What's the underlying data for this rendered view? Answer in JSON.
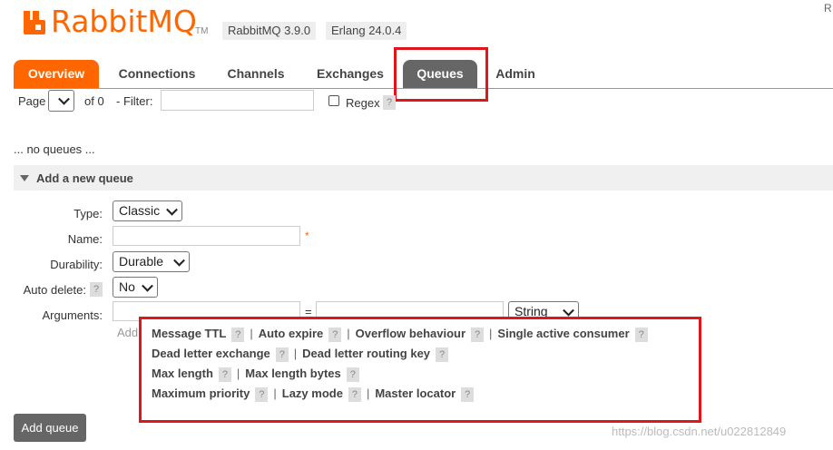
{
  "header": {
    "logo_text": "RabbitMQ",
    "logo_tm": "TM",
    "version_badge": "RabbitMQ 3.9.0",
    "erlang_badge": "Erlang 24.0.4",
    "top_right": "R"
  },
  "tabs": [
    {
      "label": "Overview"
    },
    {
      "label": "Connections"
    },
    {
      "label": "Channels"
    },
    {
      "label": "Exchanges"
    },
    {
      "label": "Queues"
    },
    {
      "label": "Admin"
    }
  ],
  "filter": {
    "page_label": "Page",
    "of_label": "of 0",
    "filter_label": "- Filter:",
    "regex_label": "Regex",
    "help": "?"
  },
  "status": "... no queues ...",
  "section_title": "Add a new queue",
  "form": {
    "type_label": "Type:",
    "type_value": "Classic",
    "name_label": "Name:",
    "name_required": "*",
    "durability_label": "Durability:",
    "durability_value": "Durable",
    "auto_delete_label": "Auto delete:",
    "auto_delete_help": "?",
    "auto_delete_value": "No",
    "arguments_label": "Arguments:",
    "equals": "=",
    "arg_type_value": "String",
    "add_label": "Add"
  },
  "hints": {
    "message_ttl": "Message TTL",
    "auto_expire": "Auto expire",
    "overflow_behaviour": "Overflow behaviour",
    "single_active_consumer": "Single active consumer",
    "dead_letter_exchange": "Dead letter exchange",
    "dead_letter_routing_key": "Dead letter routing key",
    "max_length": "Max length",
    "max_length_bytes": "Max length bytes",
    "maximum_priority": "Maximum priority",
    "lazy_mode": "Lazy mode",
    "master_locator": "Master locator",
    "sep": "|",
    "q": "?"
  },
  "add_queue_button": "Add queue",
  "watermark": "https://blog.csdn.net/u022812849",
  "colors": {
    "brand": "#ff6600",
    "highlight": "#e0161d",
    "tab_active": "#666666"
  }
}
